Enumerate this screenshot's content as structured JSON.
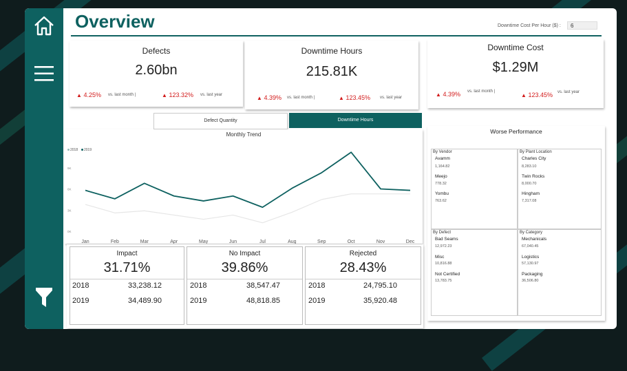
{
  "colors": {
    "accent": "#0e6160",
    "delta_bad": "#d21b1b",
    "line_2018": "#e6e6e6",
    "line_2019": "#0e6160"
  },
  "sidebar": {
    "icons": [
      "home-icon",
      "menu-icon",
      "filter-icon"
    ]
  },
  "header": {
    "title": "Overview",
    "downtime_cost_label": "Downtime Cost Per Hour ($) :",
    "downtime_cost_value": "6"
  },
  "kpis": [
    {
      "title": "Defects",
      "value": "2.60bn",
      "month_delta": "4.25%",
      "month_label": "vs. last month  |",
      "year_delta": "123.32%",
      "year_label": "vs. last year"
    },
    {
      "title": "Downtime Hours",
      "value": "215.81K",
      "month_delta": "4.39%",
      "month_label": "vs. last month  |",
      "year_delta": "123.45%",
      "year_label": "vs. last year"
    },
    {
      "title": "Downtime Cost",
      "value": "$1.29M",
      "month_delta": "4.39%",
      "month_label": "vs. last month  |",
      "year_delta": "123.45%",
      "year_label": "vs. last year"
    }
  ],
  "toggle": {
    "option1": "Defect Quantity",
    "option2": "Downtime Hours",
    "selected": "Downtime Hours"
  },
  "chart_data": {
    "type": "line",
    "title": "Monthly Trend",
    "categories": [
      "Jan",
      "Feb",
      "Mar",
      "Apr",
      "May",
      "Jun",
      "Jul",
      "Aug",
      "Sep",
      "Oct",
      "Nov",
      "Dec"
    ],
    "y_ticks": [
      "9K",
      "6K",
      "3K",
      "0K"
    ],
    "series": [
      {
        "name": "2018",
        "values": [
          3.8,
          2.6,
          2.9,
          2.3,
          1.7,
          2.3,
          1.2,
          2.7,
          4.5,
          5.3,
          5.3,
          5.3
        ]
      },
      {
        "name": "2019",
        "values": [
          5.8,
          4.6,
          6.8,
          5.0,
          4.3,
          5.0,
          3.4,
          6.1,
          8.3,
          11.2,
          6.0,
          5.8
        ]
      }
    ],
    "legend": "top-left",
    "grid": false
  },
  "worse": {
    "title": "Worse Performance",
    "groups": [
      {
        "title": "By Vendor",
        "items": [
          {
            "name": "Avamm",
            "value": "1,164.82"
          },
          {
            "name": "Meejo",
            "value": "778.32"
          },
          {
            "name": "Yombu",
            "value": "763.62"
          }
        ]
      },
      {
        "title": "By Plant Location",
        "items": [
          {
            "name": "Charles City",
            "value": "8,283.10"
          },
          {
            "name": "Twin Rocks",
            "value": "8,000.70"
          },
          {
            "name": "Hingham",
            "value": "7,317.08"
          }
        ]
      },
      {
        "title": "By Defect",
        "items": [
          {
            "name": "Bad Seams",
            "value": "12,972.23"
          },
          {
            "name": "Misc",
            "value": "10,816.88"
          },
          {
            "name": "Not Certified",
            "value": "13,783.75"
          }
        ]
      },
      {
        "title": "By Category",
        "items": [
          {
            "name": "Mechanicals",
            "value": "67,040.45"
          },
          {
            "name": "Logistics",
            "value": "57,130.97"
          },
          {
            "name": "Packaging",
            "value": "36,506.80"
          }
        ]
      }
    ]
  },
  "impact": [
    {
      "title": "Impact",
      "pct": "31.71%",
      "rows": [
        {
          "year": "2018",
          "value": "33,238.12"
        },
        {
          "year": "2019",
          "value": "34,489.90"
        }
      ]
    },
    {
      "title": "No Impact",
      "pct": "39.86%",
      "rows": [
        {
          "year": "2018",
          "value": "38,547.47"
        },
        {
          "year": "2019",
          "value": "48,818.85"
        }
      ]
    },
    {
      "title": "Rejected",
      "pct": "28.43%",
      "rows": [
        {
          "year": "2018",
          "value": "24,795.10"
        },
        {
          "year": "2019",
          "value": "35,920.48"
        }
      ]
    }
  ]
}
